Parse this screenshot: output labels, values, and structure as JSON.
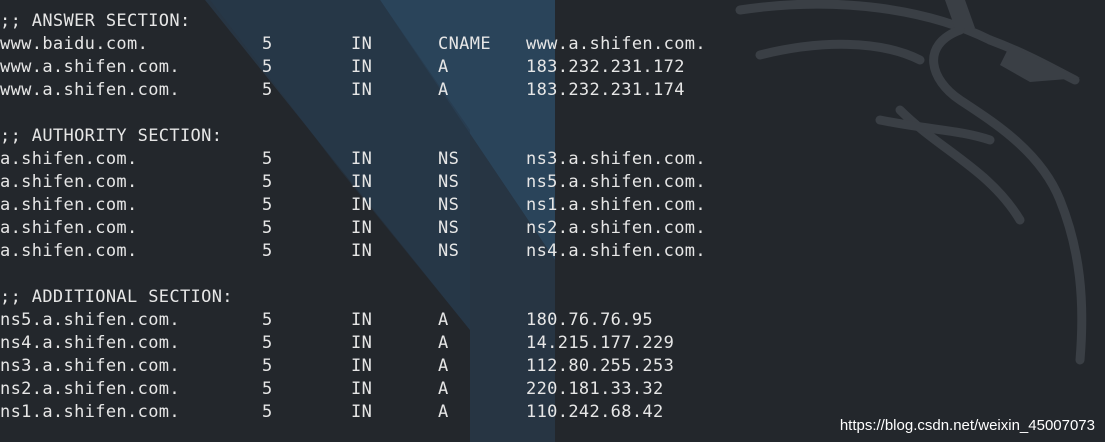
{
  "sections": {
    "answer": {
      "header": ";; ANSWER SECTION:",
      "records": [
        {
          "name": "www.baidu.com.",
          "ttl": "5",
          "class": "IN",
          "type": "CNAME",
          "data": "www.a.shifen.com."
        },
        {
          "name": "www.a.shifen.com.",
          "ttl": "5",
          "class": "IN",
          "type": "A",
          "data": "183.232.231.172"
        },
        {
          "name": "www.a.shifen.com.",
          "ttl": "5",
          "class": "IN",
          "type": "A",
          "data": "183.232.231.174"
        }
      ]
    },
    "authority": {
      "header": ";; AUTHORITY SECTION:",
      "records": [
        {
          "name": "a.shifen.com.",
          "ttl": "5",
          "class": "IN",
          "type": "NS",
          "data": "ns3.a.shifen.com."
        },
        {
          "name": "a.shifen.com.",
          "ttl": "5",
          "class": "IN",
          "type": "NS",
          "data": "ns5.a.shifen.com."
        },
        {
          "name": "a.shifen.com.",
          "ttl": "5",
          "class": "IN",
          "type": "NS",
          "data": "ns1.a.shifen.com."
        },
        {
          "name": "a.shifen.com.",
          "ttl": "5",
          "class": "IN",
          "type": "NS",
          "data": "ns2.a.shifen.com."
        },
        {
          "name": "a.shifen.com.",
          "ttl": "5",
          "class": "IN",
          "type": "NS",
          "data": "ns4.a.shifen.com."
        }
      ]
    },
    "additional": {
      "header": ";; ADDITIONAL SECTION:",
      "records": [
        {
          "name": "ns5.a.shifen.com.",
          "ttl": "5",
          "class": "IN",
          "type": "A",
          "data": "180.76.76.95"
        },
        {
          "name": "ns4.a.shifen.com.",
          "ttl": "5",
          "class": "IN",
          "type": "A",
          "data": "14.215.177.229"
        },
        {
          "name": "ns3.a.shifen.com.",
          "ttl": "5",
          "class": "IN",
          "type": "A",
          "data": "112.80.255.253"
        },
        {
          "name": "ns2.a.shifen.com.",
          "ttl": "5",
          "class": "IN",
          "type": "A",
          "data": "220.181.33.32"
        },
        {
          "name": "ns1.a.shifen.com.",
          "ttl": "5",
          "class": "IN",
          "type": "A",
          "data": "110.242.68.42"
        }
      ]
    }
  },
  "watermark": "https://blog.csdn.net/weixin_45007073",
  "theme": {
    "background": "#23272c",
    "text": "#e6e6e6",
    "accent_panel": "#2b4a63"
  },
  "background_icon": "kali-dragon-icon"
}
